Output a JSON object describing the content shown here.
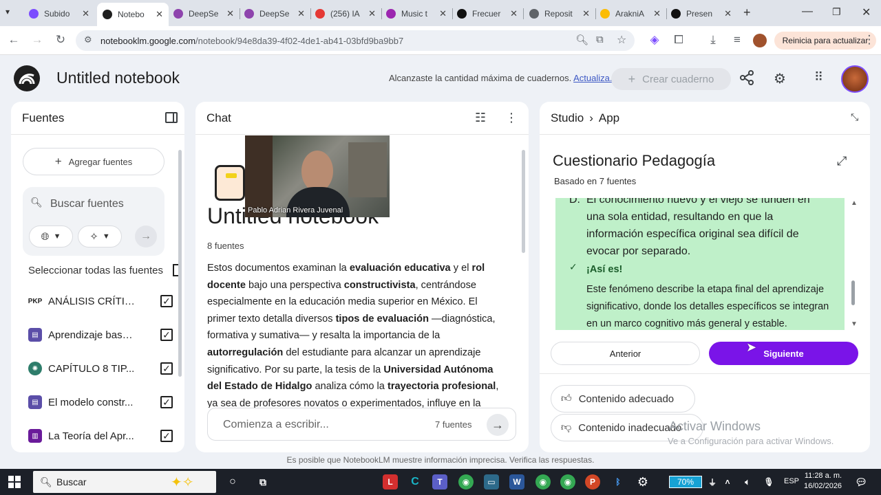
{
  "browser": {
    "tabs": [
      {
        "title": "Subido",
        "color": "#7c4dff"
      },
      {
        "title": "Notebo",
        "color": "#1f1f1f",
        "active": true
      },
      {
        "title": "DeepSe",
        "color": "#8e44ad"
      },
      {
        "title": "DeepSe",
        "color": "#8e44ad"
      },
      {
        "title": "(256) IA",
        "color": "#e53935"
      },
      {
        "title": "Music t",
        "color": "#9c27b0"
      },
      {
        "title": "Frecuer",
        "color": "#111111"
      },
      {
        "title": "Reposit",
        "color": "#5f6368"
      },
      {
        "title": "ArakniA",
        "color": "#fbbc04"
      },
      {
        "title": "Presen",
        "color": "#111111"
      }
    ],
    "url_host": "notebooklm.google.com",
    "url_path": "/notebook/94e8da39-4f02-4de1-ab41-03bfd9ba9bb7",
    "update_label": "Reinicia para actualizar"
  },
  "header": {
    "title": "Untitled notebook",
    "limit_text": "Alcanzaste la cantidad máxima de cuadernos.",
    "limit_link": "Actualiza.",
    "create_label": "Crear cuaderno"
  },
  "sources": {
    "title": "Fuentes",
    "add_label": "Agregar fuentes",
    "search_placeholder": "Buscar fuentes",
    "select_all": "Seleccionar todas las fuentes",
    "items": [
      {
        "label": "ANÁLISIS CRÍTIC...",
        "icon": "PKP",
        "checked": true
      },
      {
        "label": "Aprendizaje basa...",
        "icon": "doc",
        "checked": true
      },
      {
        "label": "CAPÍTULO 8 TIP...",
        "icon": "seal",
        "checked": true
      },
      {
        "label": "El modelo constr...",
        "icon": "doc",
        "checked": true
      },
      {
        "label": "La Teoría del Apr...",
        "icon": "book",
        "checked": true
      }
    ]
  },
  "chat": {
    "title": "Chat",
    "video_name": "Pablo Adrian Rivera Juvenal",
    "notebook_title": "Untitled notebook",
    "source_count": "8 fuentes",
    "summary_html": "Estos documentos examinan la <b>evaluación educativa</b> y el <b>rol docente</b> bajo una perspectiva <b>constructivista</b>, centrándose especialmente en la educación media superior en México. El primer texto detalla diversos <b>tipos de evaluación</b> —diagnóstica, formativa y sumativa— y resalta la importancia de la <b>autorregulación</b> del estudiante para alcanzar un aprendizaje significativo. Por su parte, la tesis de la <b>Universidad Autónoma del Estado de Hidalgo</b> analiza cómo la <b>trayectoria profesional</b>, ya sea de profesores novatos o experimentados, influye en la",
    "input_placeholder": "Comienza a escribir...",
    "input_sources": "7 fuentes"
  },
  "studio": {
    "crumb_root": "Studio",
    "crumb_leaf": "App",
    "quiz_title": "Cuestionario Pedagogía",
    "quiz_subtitle": "Basado en 7 fuentes",
    "option_letter": "D.",
    "option_text": "El conocimiento nuevo y el viejo se funden en una sola entidad, resultando en que la información específica original sea difícil de evocar por separado.",
    "correct_label": "¡Así es!",
    "explanation": "Este fenómeno describe la etapa final del aprendizaje significativo, donde los detalles específicos se integran en un marco cognitivo más general y estable.",
    "prev_label": "Anterior",
    "next_label": "Siguiente",
    "feedback_good": "Contenido adecuado",
    "feedback_bad": "Contenido inadecuado"
  },
  "footer": "Es posible que NotebookLM muestre información imprecisa. Verifica las respuestas.",
  "watermark": {
    "title": "Activar Windows",
    "subtitle": "Ve a Configuración para activar Windows."
  },
  "taskbar": {
    "search": "Buscar",
    "battery": "70%",
    "lang": "ESP",
    "time": "11:28 a. m.",
    "date": "16/02/2026"
  }
}
